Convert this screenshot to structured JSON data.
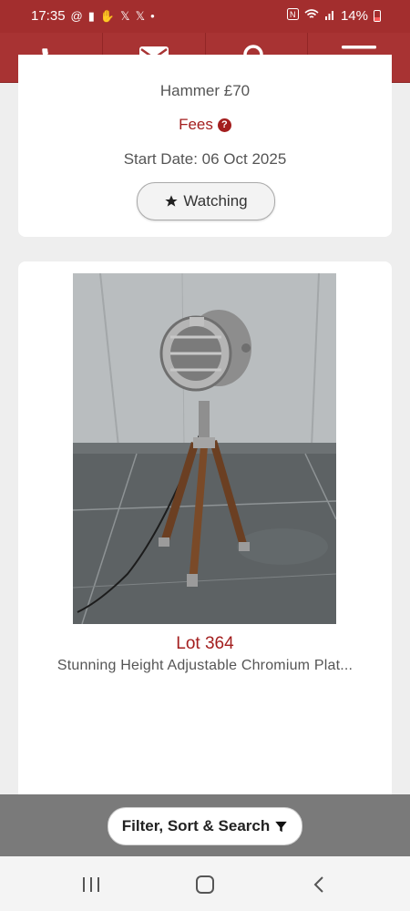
{
  "status_bar": {
    "time": "17:35",
    "battery": "14%",
    "left_icons": [
      "threads-icon",
      "notification-icon",
      "hand-icon",
      "x-icon",
      "x-icon",
      "dot-icon"
    ],
    "right_icons": [
      "nfc-icon",
      "wifi-icon",
      "signal-icon",
      "battery-icon"
    ]
  },
  "nav": {
    "items": [
      "phone-icon",
      "mail-icon",
      "search-icon",
      "menu-icon"
    ]
  },
  "previous_lot": {
    "hammer": "Hammer £70",
    "fees_label": "Fees",
    "start_date": "Start Date: 06 Oct 2025",
    "watch_label": "Watching"
  },
  "lot": {
    "number": "Lot 364",
    "description": "Stunning Height Adjustable Chromium Plat..."
  },
  "filter": {
    "label": "Filter, Sort & Search"
  },
  "colors": {
    "brand": "#a83333",
    "accent_text": "#a31e1e"
  }
}
